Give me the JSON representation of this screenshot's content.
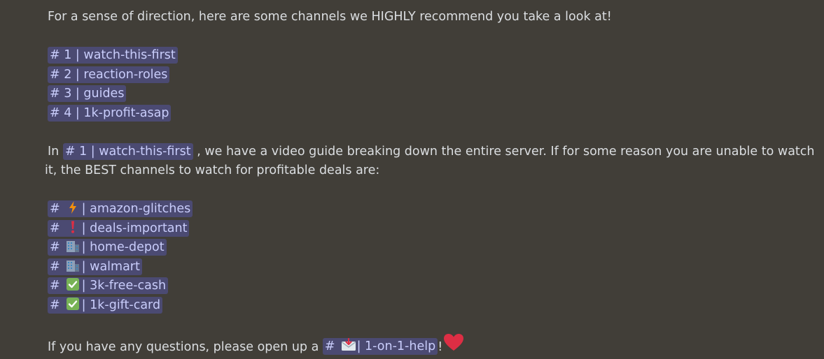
{
  "message": {
    "intro": "For a sense of direction, here are some channels we HIGHLY recommend you take a look at!",
    "recommended_channels": [
      {
        "name": "# 1 | watch-this-first"
      },
      {
        "name": "# 2 | reaction-roles"
      },
      {
        "name": "# 3 | guides"
      },
      {
        "name": "# 4 | 1k-profit-asap"
      }
    ],
    "paragraph": {
      "prefix": "In",
      "channel": "# 1 | watch-this-first",
      "suffix": ", we have a video guide breaking down the entire server. If for some reason you are unable to watch",
      "line2": "it, the BEST channels to watch for profitable deals are:"
    },
    "deal_channels": [
      {
        "hash": "#",
        "icon": "lightning-icon",
        "label": "| amazon-glitches"
      },
      {
        "hash": "#",
        "icon": "exclamation-icon",
        "label": "| deals-important"
      },
      {
        "hash": "#",
        "icon": "building-icon",
        "label": "| home-depot"
      },
      {
        "hash": "#",
        "icon": "building-icon",
        "label": "| walmart"
      },
      {
        "hash": "#",
        "icon": "check-box-icon",
        "label": "| 3k-free-cash"
      },
      {
        "hash": "#",
        "icon": "check-box-icon",
        "label": "| 1k-gift-card"
      }
    ],
    "closing": {
      "prefix": "If you have any questions, please open up a",
      "channel_hash": "#",
      "channel_icon": "envelope-icon",
      "channel_label": "| 1-on-1-help",
      "suffix": "!",
      "emoji": "heart-icon"
    }
  },
  "colors": {
    "background": "#413e38",
    "text": "#dbdee1",
    "mention_bg": "#4b4a72",
    "mention_text": "#c9cdfb",
    "lightning": "#f4900c",
    "exclamation": "#dd2e44",
    "check": "#77b255",
    "heart": "#dd2e44"
  }
}
